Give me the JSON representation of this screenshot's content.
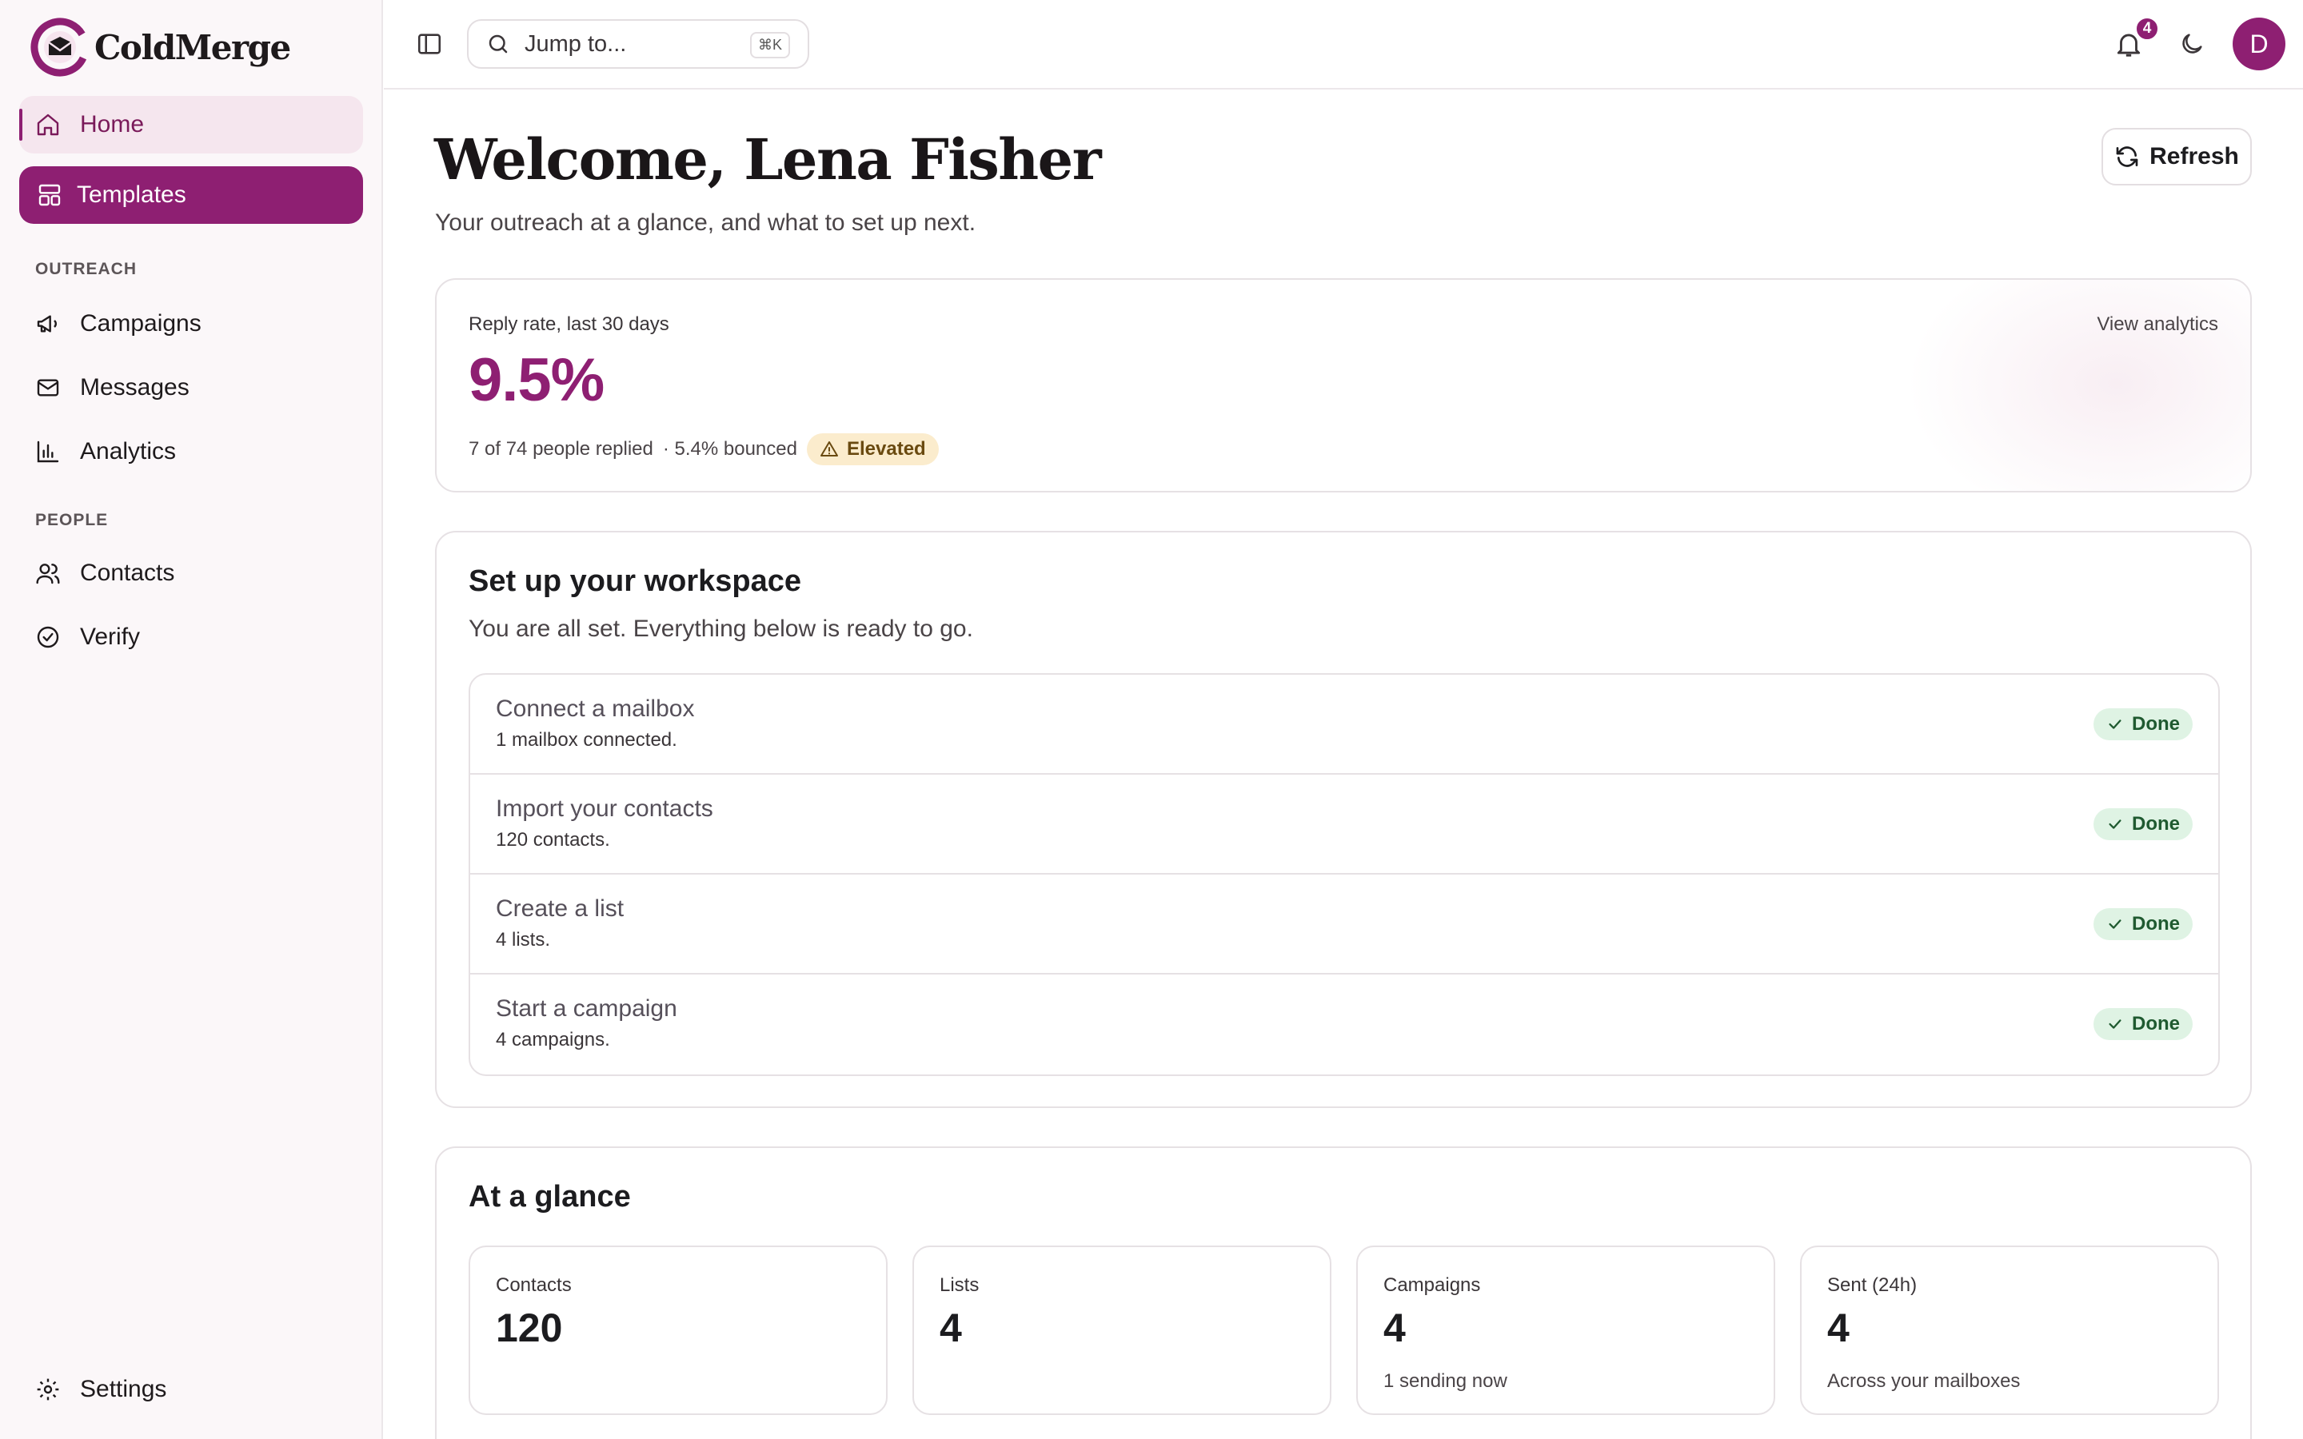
{
  "brand": {
    "name": "ColdMerge",
    "accent": "#8e1f72"
  },
  "sidebar": {
    "primary": [
      {
        "label": "Home",
        "icon": "home-icon"
      },
      {
        "label": "Templates",
        "icon": "layout-icon"
      }
    ],
    "sections": [
      {
        "title": "OUTREACH",
        "items": [
          {
            "label": "Campaigns",
            "icon": "megaphone-icon"
          },
          {
            "label": "Messages",
            "icon": "mail-icon"
          },
          {
            "label": "Analytics",
            "icon": "bar-chart-icon"
          }
        ]
      },
      {
        "title": "PEOPLE",
        "items": [
          {
            "label": "Contacts",
            "icon": "users-icon"
          },
          {
            "label": "Verify",
            "icon": "check-circle-icon"
          }
        ]
      }
    ],
    "settings": {
      "label": "Settings",
      "icon": "gear-icon"
    }
  },
  "topbar": {
    "search_placeholder": "Jump to...",
    "search_shortcut": "⌘K",
    "notifications_count": "4",
    "avatar_initial": "D"
  },
  "page": {
    "title": "Welcome, Lena Fisher",
    "subtitle": "Your outreach at a glance, and what to set up next.",
    "refresh_label": "Refresh"
  },
  "reply_card": {
    "label": "Reply rate, last 30 days",
    "value": "9.5%",
    "replied_text": "7 of 74 people replied",
    "bounced_text": "· 5.4% bounced",
    "status_badge": "Elevated",
    "link_label": "View analytics"
  },
  "setup": {
    "title": "Set up your workspace",
    "description": "You are all set. Everything below is ready to go.",
    "steps": [
      {
        "title": "Connect a mailbox",
        "detail": "1 mailbox connected.",
        "status": "Done"
      },
      {
        "title": "Import your contacts",
        "detail": "120 contacts.",
        "status": "Done"
      },
      {
        "title": "Create a list",
        "detail": "4 lists.",
        "status": "Done"
      },
      {
        "title": "Start a campaign",
        "detail": "4 campaigns.",
        "status": "Done"
      }
    ]
  },
  "glance": {
    "title": "At a glance",
    "stats": [
      {
        "label": "Contacts",
        "value": "120",
        "sub": ""
      },
      {
        "label": "Lists",
        "value": "4",
        "sub": ""
      },
      {
        "label": "Campaigns",
        "value": "4",
        "sub": "1 sending now"
      },
      {
        "label": "Sent (24h)",
        "value": "4",
        "sub": "Across your mailboxes"
      }
    ]
  }
}
